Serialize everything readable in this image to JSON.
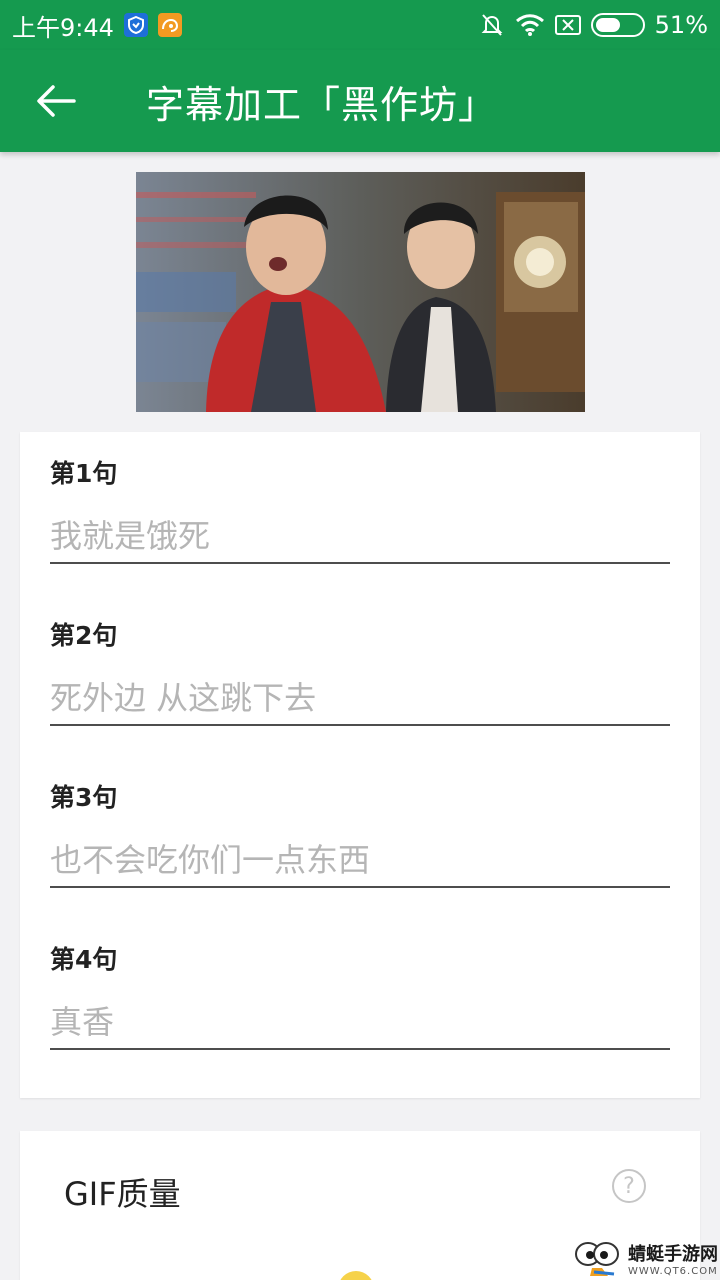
{
  "status_bar": {
    "time": "上午9:44",
    "battery": "51%",
    "badge_a_icon": "shield-app-icon",
    "badge_b_icon": "uc-browser-icon"
  },
  "app_bar": {
    "title": "字幕加工「黑作坊」",
    "back_icon": "arrow-left-icon",
    "color": "#159a4f"
  },
  "sentences": [
    {
      "label": "第1句",
      "value": "我就是饿死"
    },
    {
      "label": "第2句",
      "value": "死外边 从这跳下去"
    },
    {
      "label": "第3句",
      "value": "也不会吃你们一点东西"
    },
    {
      "label": "第4句",
      "value": "真香"
    }
  ],
  "quality": {
    "label": "GIF质量",
    "help_symbol": "?"
  },
  "watermark": {
    "main": "蜻蜓手游网",
    "sub": "WWW.QT6.COM"
  }
}
